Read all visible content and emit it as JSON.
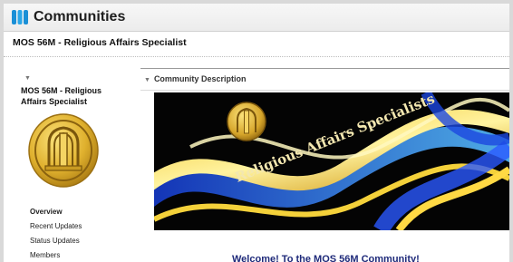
{
  "app": {
    "title": "Communities",
    "icon": "communities-icon"
  },
  "community": {
    "title": "MOS 56M - Religious Affairs Specialist"
  },
  "sidebar": {
    "name_line1": "MOS 56M - Religious",
    "name_line2": "Affairs Specialist",
    "nav": [
      {
        "label": "Overview",
        "active": true
      },
      {
        "label": "Recent Updates"
      },
      {
        "label": "Status Updates"
      },
      {
        "label": "Members"
      }
    ]
  },
  "section": {
    "title": "Community Description"
  },
  "banner": {
    "text": "Religious Affairs Specialists"
  },
  "welcome": {
    "text": "Welcome! To the MOS 56M Community!"
  },
  "colors": {
    "title_blue": "#1f2a7a",
    "gold": "#d9b02b",
    "app_icon": "#1a8fd6"
  }
}
